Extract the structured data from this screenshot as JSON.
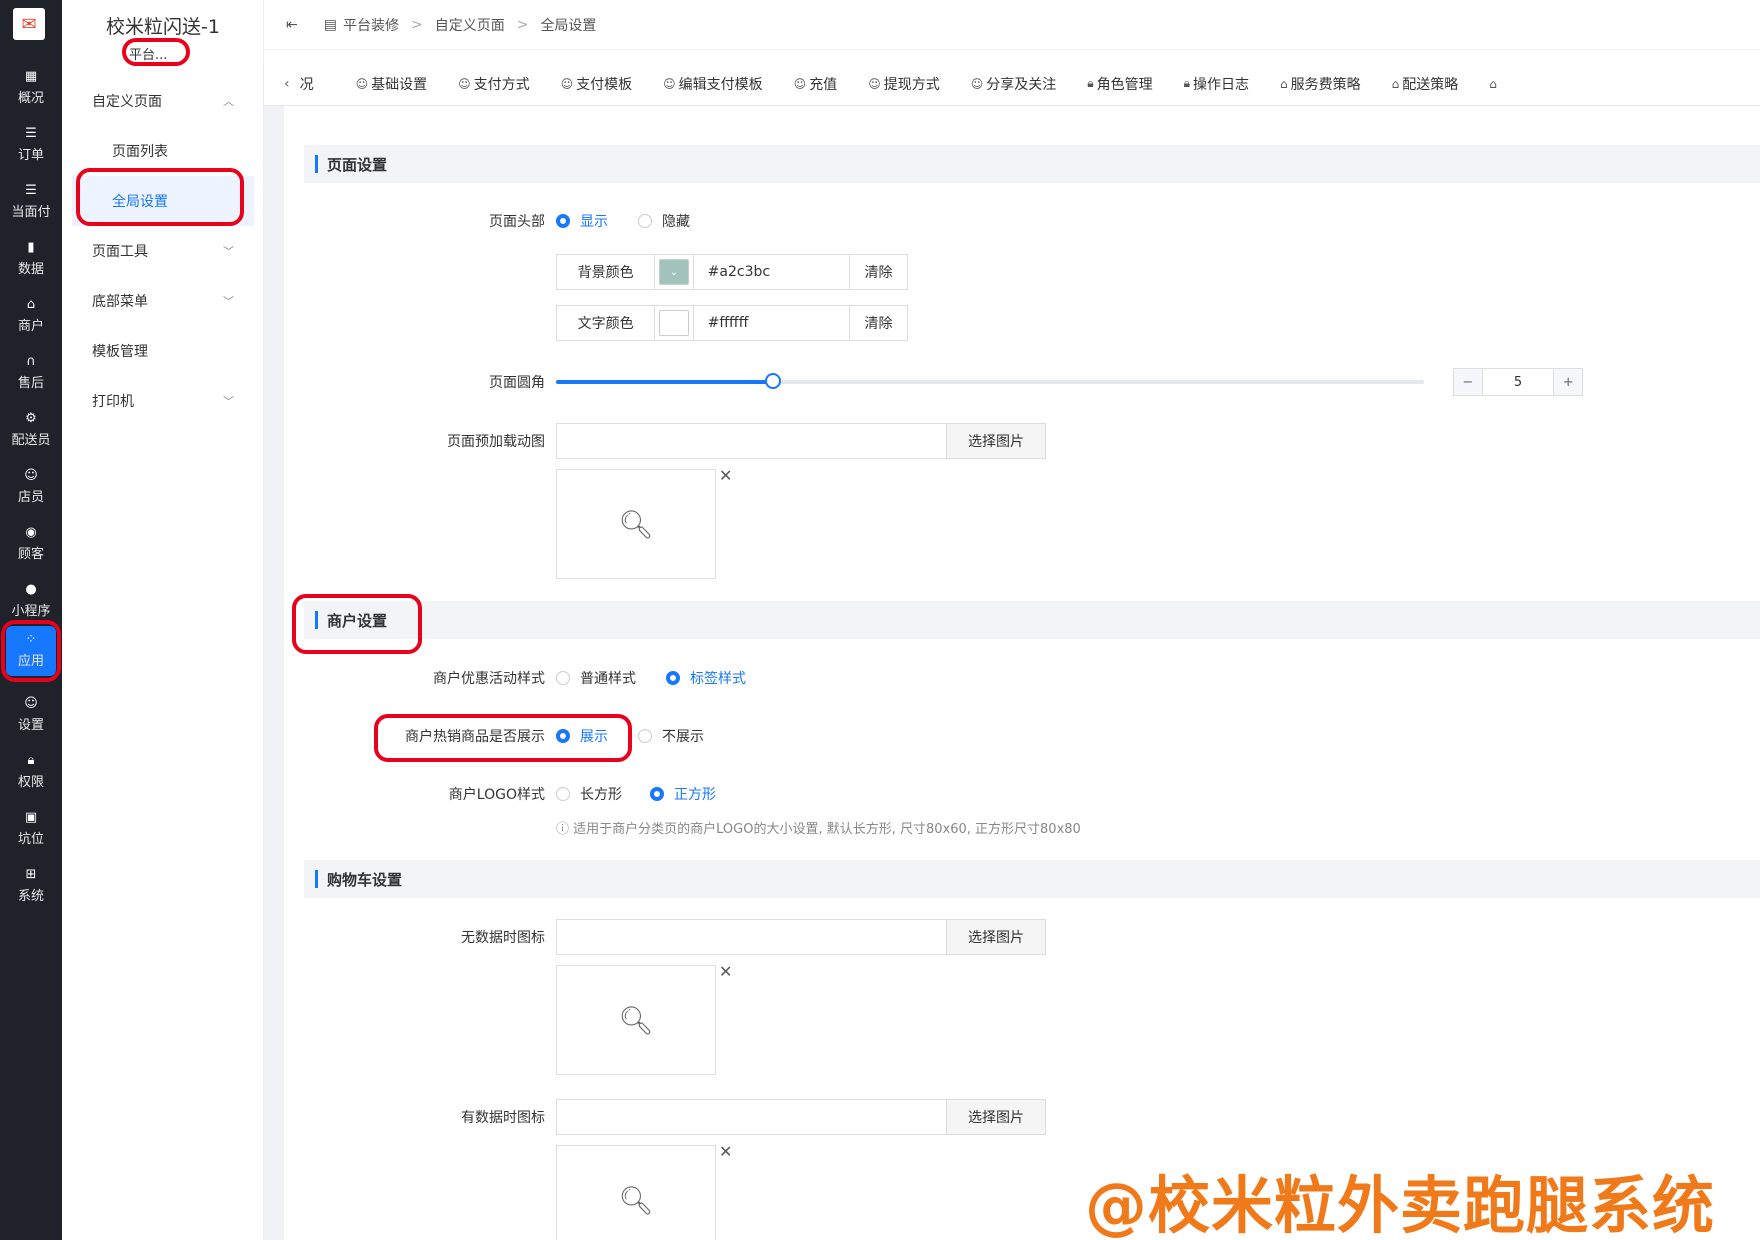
{
  "rail": {
    "items": [
      {
        "label": "概况",
        "icon": "dashboard-icon"
      },
      {
        "label": "订单",
        "icon": "list-icon"
      },
      {
        "label": "当面付",
        "icon": "list-icon"
      },
      {
        "label": "数据",
        "icon": "bar-chart-icon"
      },
      {
        "label": "商户",
        "icon": "store-icon"
      },
      {
        "label": "售后",
        "icon": "headset-icon"
      },
      {
        "label": "配送员",
        "icon": "scooter-icon"
      },
      {
        "label": "店员",
        "icon": "user-icon"
      },
      {
        "label": "顾客",
        "icon": "user-circle-icon"
      },
      {
        "label": "小程序",
        "icon": "wechat-icon"
      },
      {
        "label": "应用",
        "icon": "apps-icon"
      },
      {
        "label": "设置",
        "icon": "user-gear-icon"
      },
      {
        "label": "权限",
        "icon": "lock-icon"
      },
      {
        "label": "坑位",
        "icon": "slot-icon"
      },
      {
        "label": "系统",
        "icon": "windows-icon"
      }
    ]
  },
  "subnav": {
    "brand": "校米粒闪送-1",
    "brand_sub": "平台...",
    "items": [
      "自定义页面",
      "页面列表",
      "全局设置",
      "页面工具",
      "底部菜单",
      "模板管理",
      "打印机"
    ]
  },
  "topbar": {
    "crumb1": "平台装修",
    "sep": ">",
    "crumb2": "自定义页面",
    "crumb3": "全局设置"
  },
  "tabs": [
    "况",
    "基础设置",
    "支付方式",
    "支付模板",
    "编辑支付模板",
    "充值",
    "提现方式",
    "分享及关注",
    "角色管理",
    "操作日志",
    "服务费策略",
    "配送策略"
  ],
  "sections": {
    "page": "页面设置",
    "merchant": "商户设置",
    "cart": "购物车设置"
  },
  "page_settings": {
    "header_label": "页面头部",
    "show": "显示",
    "hide": "隐藏",
    "bg_label": "背景颜色",
    "bg_value": "#a2c3bc",
    "clear": "清除",
    "text_label": "文字颜色",
    "text_value": "#ffffff",
    "radius_label": "页面圆角",
    "radius_value": "5",
    "radius_max": 20,
    "preload_label": "页面预加载动图",
    "choose": "选择图片"
  },
  "merchant_settings": {
    "promo_label": "商户优惠活动样式",
    "normal": "普通样式",
    "tag": "标签样式",
    "hot_label": "商户热销商品是否展示",
    "show": "展示",
    "noshow": "不展示",
    "logo_label": "商户LOGO样式",
    "rect": "长方形",
    "square": "正方形",
    "hint": "适用于商户分类页的商户LOGO的大小设置, 默认长方形, 尺寸80x60, 正方形尺寸80x80"
  },
  "cart_settings": {
    "empty_label": "无数据时图标",
    "has_label": "有数据时图标"
  },
  "watermark": "@校米粒外卖跑腿系统",
  "colors": {
    "accent": "#1677ff",
    "rail": "#1f2329",
    "annotation": "#e8001c",
    "bg_swatch": "#a2c3bc"
  }
}
